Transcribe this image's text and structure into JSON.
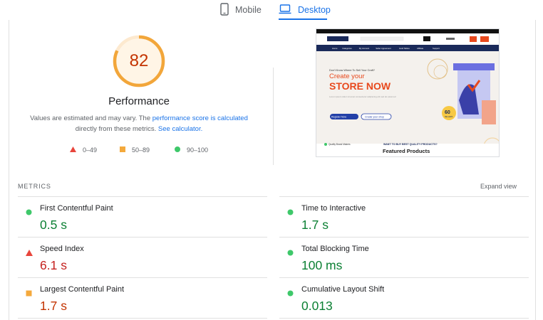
{
  "tabs": [
    {
      "label": "Mobile",
      "icon": "phone-icon",
      "active": false
    },
    {
      "label": "Desktop",
      "icon": "laptop-icon",
      "active": true
    }
  ],
  "performance": {
    "score": "82",
    "score_fraction": 0.82,
    "title": "Performance",
    "desc_prefix": "Values are estimated and may vary. The ",
    "desc_link1": "performance score is calculated",
    "desc_middle": " directly from these metrics. ",
    "desc_link2": "See calculator."
  },
  "legend": [
    {
      "shape": "triangle",
      "color": "#e8453c",
      "label": "0–49"
    },
    {
      "shape": "square",
      "color": "#f4a93c",
      "label": "50–89"
    },
    {
      "shape": "circle",
      "color": "#3ec86a",
      "label": "90–100"
    }
  ],
  "screenshot_preview": {
    "nav_items": [
      "Home",
      "Categories",
      "My Account",
      "Seller Agreement",
      "Gold Tables",
      "Affiliate",
      "Support"
    ],
    "eyebrow": "Don't Know Where To Sell Your Craft?",
    "headline_1": "Create your",
    "headline_2": "STORE NOW",
    "sub_text": "Lorem ipsum dolor sit amet consectetur adipiscing elit sed do eiusmod",
    "button_primary": "Register Now",
    "button_secondary": "Create your shop",
    "badge": "60",
    "badge_sub": "SELLERS",
    "footer_left": "Quality Brand Makers",
    "footer_tagline": "WANT TO BUY BEST QUALITY PRODUCTS?",
    "featured": "Featured Products",
    "colors": {
      "brand": "#e8491d",
      "navy": "#1a2a5a",
      "primary_button": "#2340a8"
    }
  },
  "metrics": {
    "section_label": "METRICS",
    "expand_label": "Expand view",
    "items": [
      {
        "name": "First Contentful Paint",
        "value": "0.5 s",
        "status": "good",
        "marker": "circle",
        "color": "#3ec86a"
      },
      {
        "name": "Time to Interactive",
        "value": "1.7 s",
        "status": "good",
        "marker": "circle",
        "color": "#3ec86a"
      },
      {
        "name": "Speed Index",
        "value": "6.1 s",
        "status": "poor",
        "marker": "triangle",
        "color": "#e8453c"
      },
      {
        "name": "Total Blocking Time",
        "value": "100 ms",
        "status": "good",
        "marker": "circle",
        "color": "#3ec86a"
      },
      {
        "name": "Largest Contentful Paint",
        "value": "1.7 s",
        "status": "average",
        "marker": "square",
        "color": "#f4a93c"
      },
      {
        "name": "Cumulative Layout Shift",
        "value": "0.013",
        "status": "good",
        "marker": "circle",
        "color": "#3ec86a"
      }
    ]
  }
}
